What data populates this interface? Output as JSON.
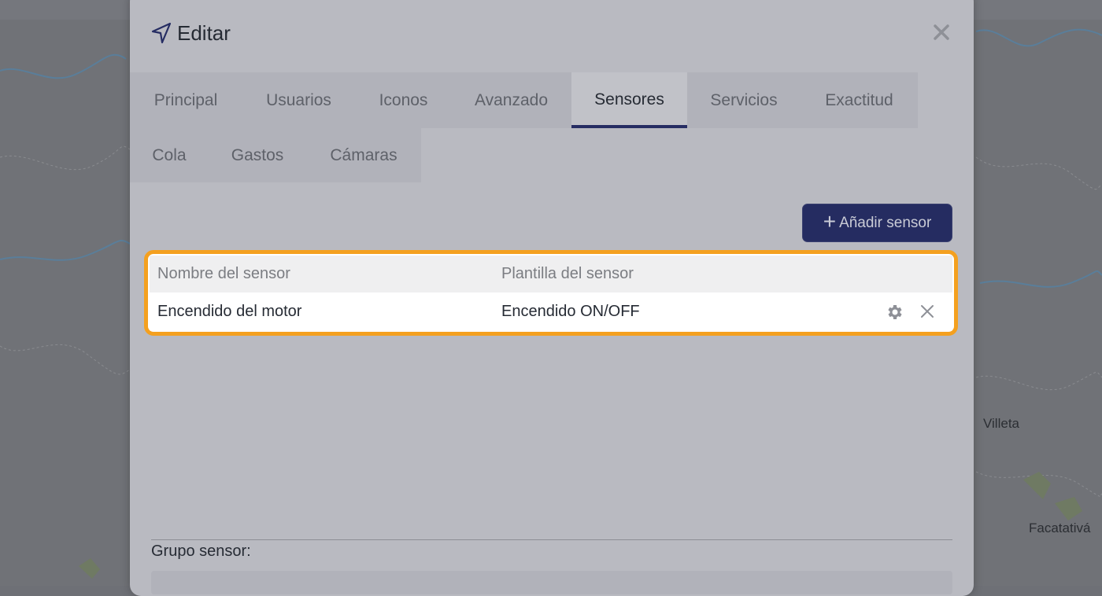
{
  "modal": {
    "title": "Editar",
    "title_icon": "navigation-arrow-icon",
    "close_icon": "close-icon"
  },
  "tabs": {
    "row1": [
      {
        "label": "Principal"
      },
      {
        "label": "Usuarios"
      },
      {
        "label": "Iconos"
      },
      {
        "label": "Avanzado"
      },
      {
        "label": "Sensores",
        "active": true
      },
      {
        "label": "Servicios"
      },
      {
        "label": "Exactitud"
      }
    ],
    "row2": [
      {
        "label": "Cola"
      },
      {
        "label": "Gastos"
      },
      {
        "label": "Cámaras"
      }
    ]
  },
  "sensors": {
    "add_button_label": "Añadir sensor",
    "add_button_icon": "plus-icon",
    "columns": [
      "Nombre del sensor",
      "Plantilla del sensor"
    ],
    "rows": [
      {
        "name": "Encendido del motor",
        "template": "Encendido ON/OFF",
        "actions": [
          "gear-icon",
          "delete-icon"
        ]
      }
    ],
    "highlight_color": "#f4a01f"
  },
  "group": {
    "label": "Grupo sensor:"
  },
  "map": {
    "labels": [
      "Villeta",
      "Facatativá"
    ]
  },
  "colors": {
    "accent": "#252c61",
    "modal_bg": "#b9bac1"
  }
}
